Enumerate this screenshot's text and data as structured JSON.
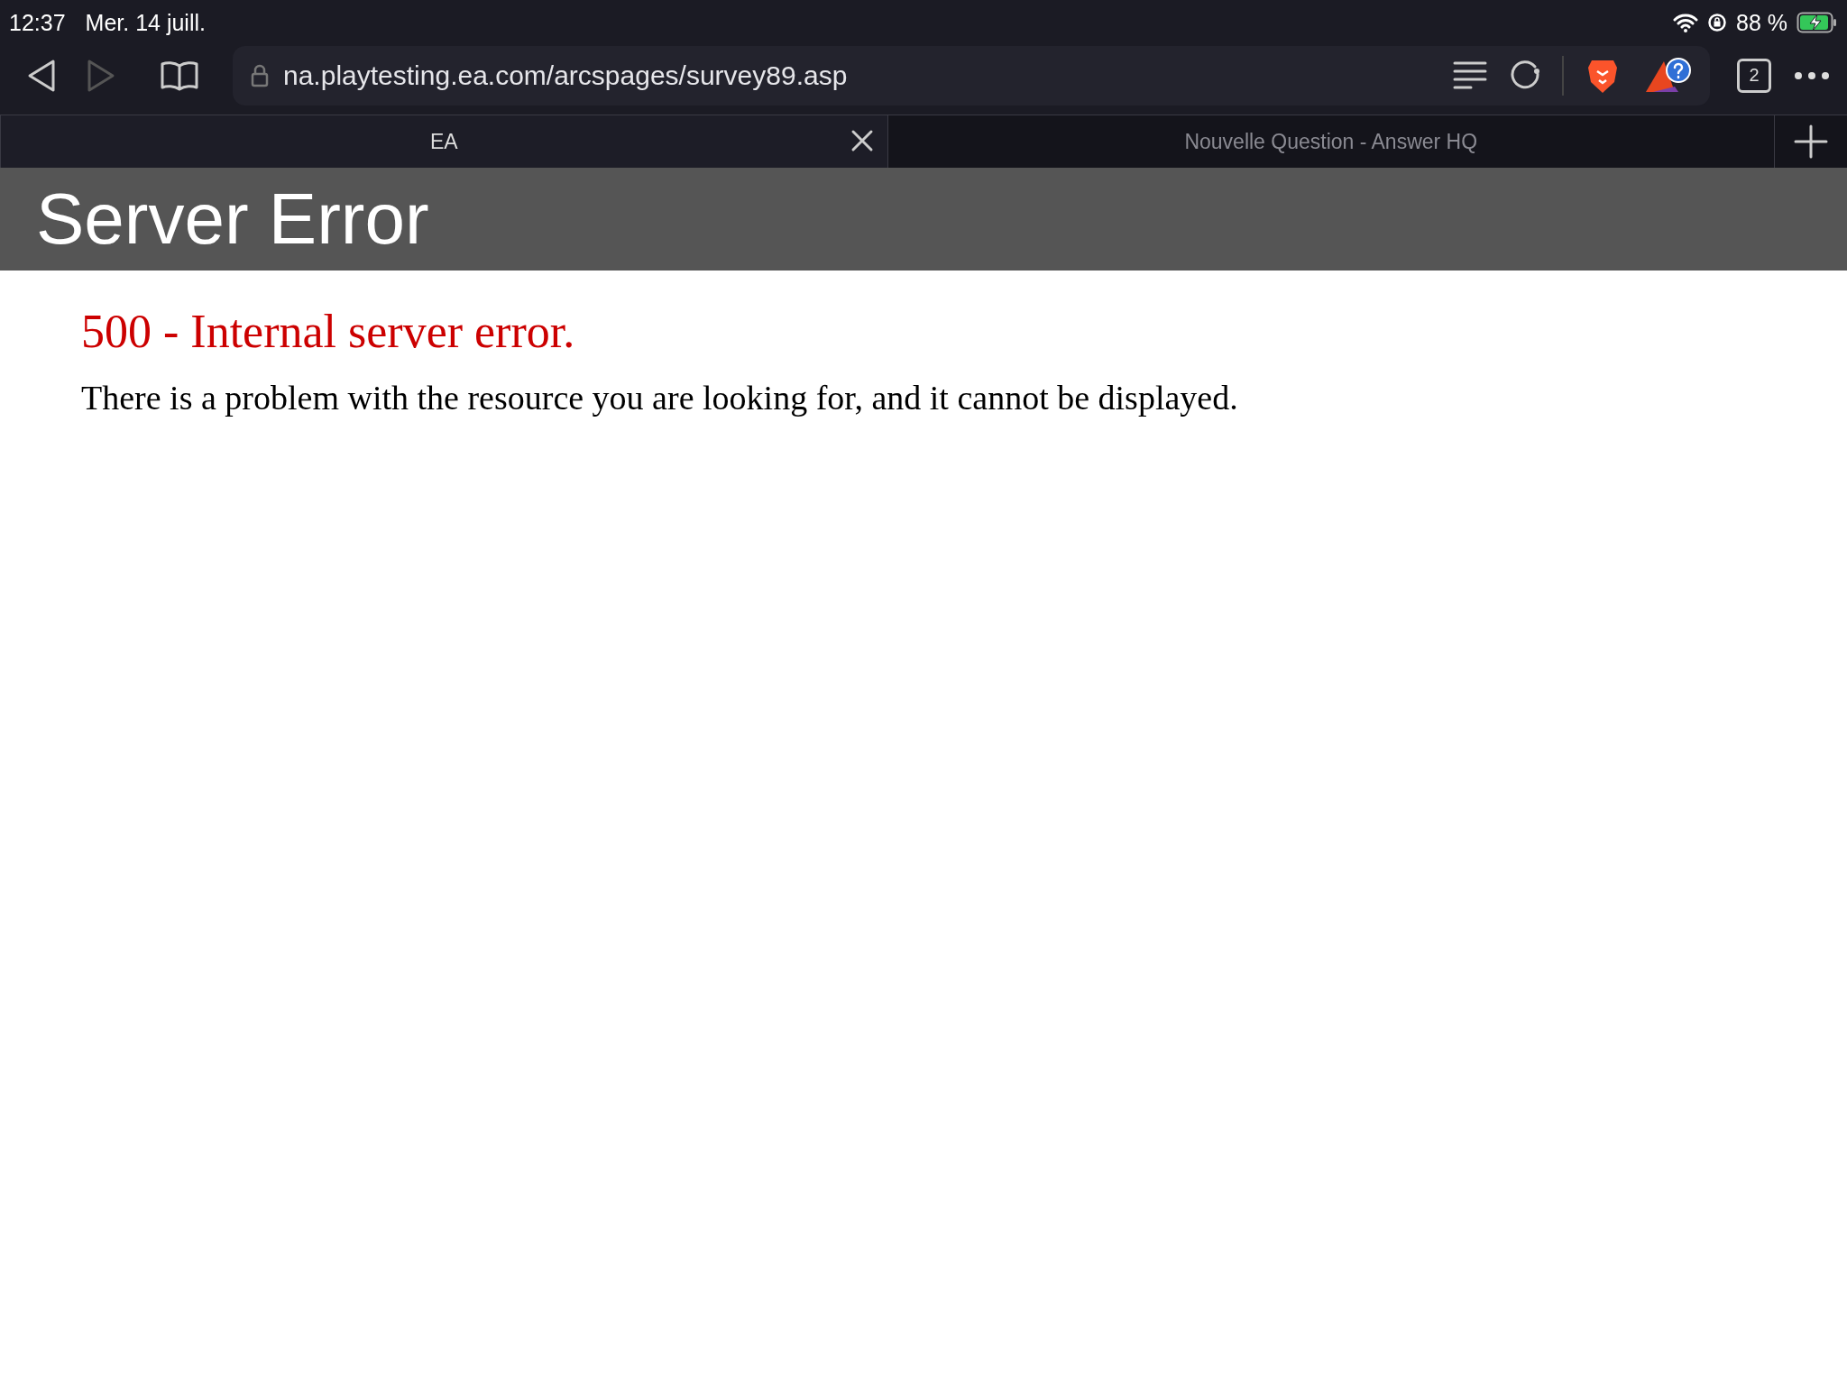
{
  "status_bar": {
    "time": "12:37",
    "date": "Mer. 14 juill.",
    "battery": "88 %"
  },
  "toolbar": {
    "url": "na.playtesting.ea.com/arcspages/survey89.asp",
    "tab_count": "2"
  },
  "tabs": [
    {
      "label": "EA",
      "selected": true
    },
    {
      "label": "Nouvelle Question - Answer HQ",
      "selected": false
    }
  ],
  "page": {
    "header": "Server Error",
    "error_title": "500 - Internal server error.",
    "message": "There is a problem with the resource you are looking for, and it cannot be displayed."
  }
}
